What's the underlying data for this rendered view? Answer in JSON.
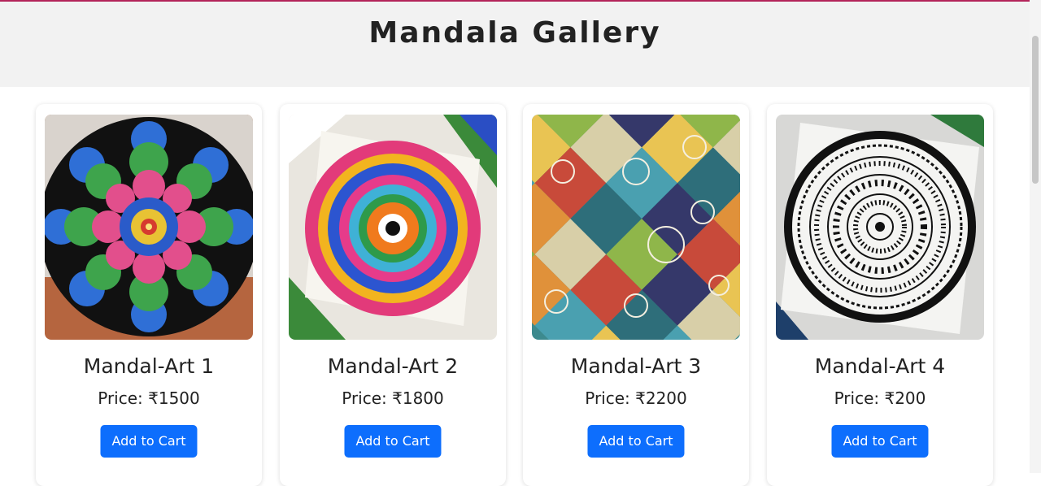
{
  "page": {
    "title": "Mandala Gallery",
    "accent_color": "#b3245a",
    "button_color": "#0d6efd"
  },
  "products": [
    {
      "name": "Mandal-Art 1",
      "price": "Price: ₹1500",
      "button": "Add to Cart",
      "image": "dot-mandala-image"
    },
    {
      "name": "Mandal-Art 2",
      "price": "Price: ₹1800",
      "button": "Add to Cart",
      "image": "colorful-mandala-image"
    },
    {
      "name": "Mandal-Art 3",
      "price": "Price: ₹2200",
      "button": "Add to Cart",
      "image": "patchwork-mandala-image"
    },
    {
      "name": "Mandal-Art 4",
      "price": "Price: ₹200",
      "button": "Add to Cart",
      "image": "black-ink-mandala-image"
    }
  ]
}
